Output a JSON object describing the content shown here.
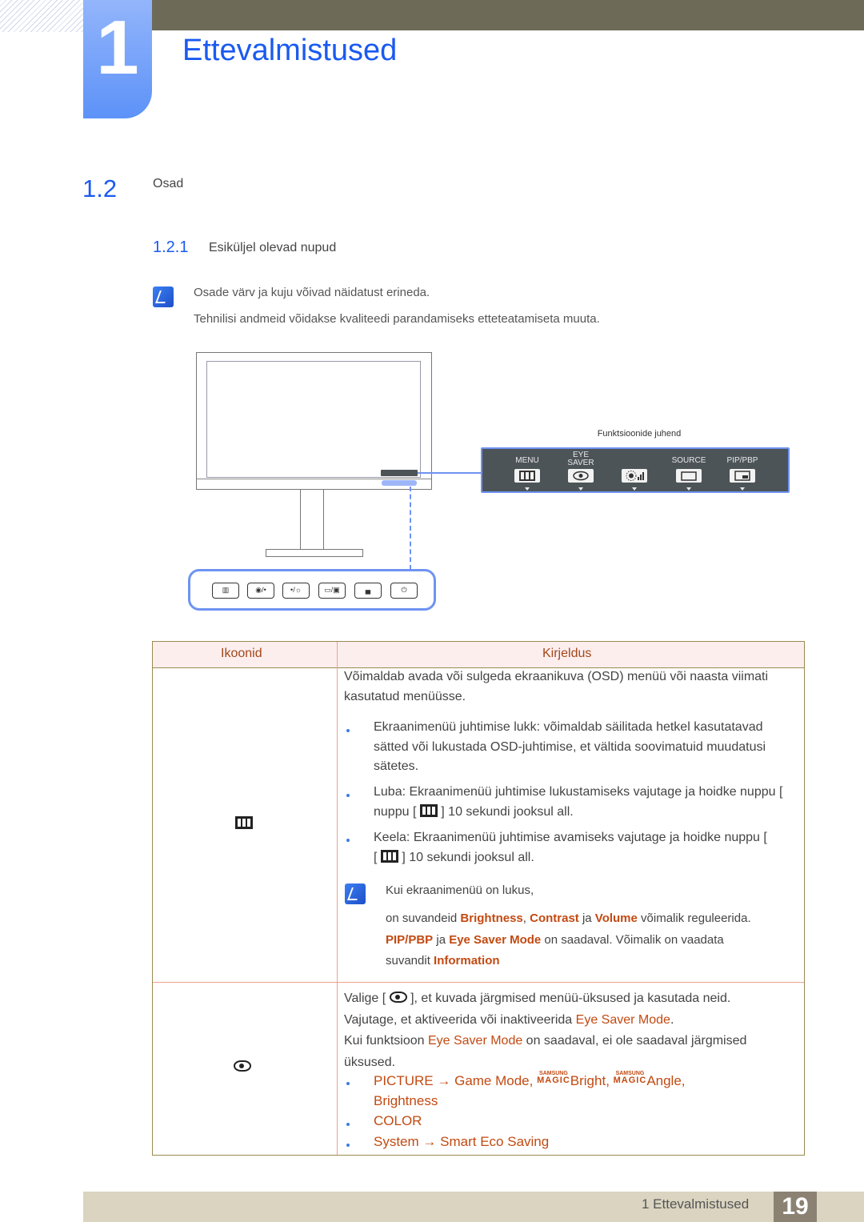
{
  "chapter": {
    "number": "1",
    "title": "Ettevalmistused"
  },
  "section": {
    "number": "1.2",
    "title": "Osad"
  },
  "subsection": {
    "number": "1.2.1",
    "title": "Esiküljel olevad nupud"
  },
  "notes": [
    "Osade värv ja kuju võivad näidatust erineda.",
    "Tehnilisi andmeid võidakse kvaliteedi parandamiseks etteteatamiseta muuta."
  ],
  "diagram": {
    "guide_title": "Funktsioonide juhend",
    "guide_items": [
      {
        "label": "MENU",
        "icon": "menu-icon"
      },
      {
        "label_line1": "EYE",
        "label_line2": "SAVER",
        "icon": "eye-saver-icon"
      },
      {
        "label": "",
        "icon": "brightness-icon"
      },
      {
        "label": "SOURCE",
        "icon": "source-icon"
      },
      {
        "label": "PIP/PBP",
        "icon": "pip-pbp-icon"
      }
    ],
    "panel_buttons": [
      {
        "glyph": "▥",
        "icon": "menu-button-icon"
      },
      {
        "glyph": "◉/•",
        "icon": "eye-saver-button-icon"
      },
      {
        "glyph": "•/☼",
        "icon": "brightness-button-icon"
      },
      {
        "glyph": "▭/▣",
        "icon": "source-button-icon"
      },
      {
        "glyph": "▄",
        "icon": "pip-button-icon"
      },
      {
        "glyph": "⏻",
        "icon": "power-button-icon"
      }
    ],
    "colors": {
      "panel_border": "#6f93f2",
      "osd_bg": "#4c5458"
    }
  },
  "table": {
    "headers": [
      "Ikoonid",
      "Kirjeldus"
    ],
    "row1": {
      "icon": "menu-icon",
      "intro": "Võimaldab avada või sulgeda ekraanikuva (OSD) menüü või naasta viimati kasutatud menüüsse.",
      "bullets": [
        "Ekraanimenüü juhtimise lukk: võimaldab säilitada hetkel kasutatavad sätted või lukustada OSD-juhtimise, et vältida soovimatuid muudatusi sätetes.",
        "Luba: Ekraanimenüü juhtimise lukustamiseks vajutage ja hoidke nuppu [",
        "] 10 sekundi jooksul all.",
        "Keela: Ekraanimenüü juhtimise avamiseks vajutage ja hoidke nuppu [",
        "] 10 sekundi jooksul all."
      ],
      "note_title": "Kui ekraanimenüü on lukus,",
      "note_parts": {
        "p1": "on suvandeid ",
        "brightness": "Brightness",
        "comma": ", ",
        "contrast": "Contrast",
        "ja1": " ja ",
        "volume": "Volume",
        "p2": " võimalik reguleerida.",
        "pip": "PIP/PBP",
        "ja2": " ja ",
        "eyesaver": "Eye Saver Mode",
        "p3": " on saadaval. Võimalik on vaadata",
        "p4": "suvandit ",
        "information": "Information"
      }
    },
    "row2": {
      "icon": "eye-saver-icon",
      "line1a": "Valige [",
      "line1b": "], et kuvada järgmised menüü-üksused ja kasutada neid.",
      "line2a": "Vajutage, et aktiveerida või inaktiveerida ",
      "line2b": "Eye Saver Mode",
      "line2c": ".",
      "line3a": "Kui funktsioon ",
      "line3b": "Eye Saver Mode",
      "line3c": " on saadaval, ei ole saadaval järgmised",
      "line4": "üksused.",
      "bullets": {
        "b1": {
          "picture": "PICTURE",
          "arrow": "→",
          "game": "Game Mode",
          "magic_top": "SAMSUNG",
          "magic_bot": "MAGIC",
          "bright": "Bright",
          "angle": "Angle",
          "brightness": "Brightness"
        },
        "b2": "COLOR",
        "b3": {
          "system": "System",
          "arrow": "→",
          "eco": "Smart Eco Saving"
        }
      }
    }
  },
  "footer": {
    "chapter_label": "1 Ettevalmistused",
    "page": "19"
  },
  "colors": {
    "heading_blue": "#1a5af0",
    "emphasis": "#c24a12",
    "topbar": "#6d6b58",
    "footer": "#dad4c0",
    "page_box": "#8b8273"
  }
}
